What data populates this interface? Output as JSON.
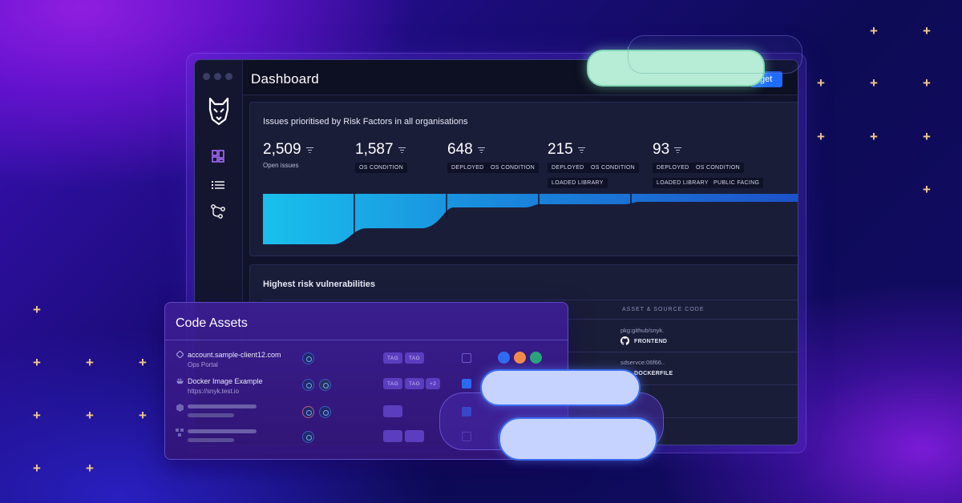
{
  "window": {
    "title": "Dashboard",
    "top_button_label": "get"
  },
  "sidebar": {
    "logo": "wolf-logo-icon",
    "items": [
      {
        "icon": "dashboard-icon"
      },
      {
        "icon": "list-icon"
      },
      {
        "icon": "graph-icon"
      }
    ]
  },
  "risk_card": {
    "title": "Issues prioritised by Risk Factors in all organisations",
    "metrics": [
      {
        "value": "2,509",
        "label": "Open issues",
        "tags": []
      },
      {
        "value": "1,587",
        "tags": [
          "OS CONDITION"
        ]
      },
      {
        "value": "648",
        "tags": [
          "DEPLOYED",
          "OS CONDITION"
        ]
      },
      {
        "value": "215",
        "tags": [
          "DEPLOYED",
          "OS CONDITION",
          "LOADED LIBRARY"
        ]
      },
      {
        "value": "93",
        "tags": [
          "DEPLOYED",
          "OS CONDITION",
          "LOADED LIBRARY",
          "PUBLIC FACING"
        ]
      }
    ]
  },
  "vuln_card": {
    "title": "Highest risk vulnerabilities",
    "column_header": "ASSET & SOURCE CODE",
    "rows": [
      {
        "asset": "pkg:github/snyk.",
        "source": "FRONTEND",
        "source_icon": "github-icon"
      },
      {
        "asset": "sdservce:06f66..",
        "source": "DOCKERFILE",
        "source_icon": "docker-icon"
      }
    ]
  },
  "code_assets": {
    "title": "Code Assets",
    "rows": [
      {
        "name": "account.sample-client12.com",
        "sub": "Ops Portal",
        "tags": [
          "TAG",
          "TAG"
        ]
      },
      {
        "name": "Docker Image Example",
        "sub": "https://snyk.test.io",
        "tags": [
          "TAG",
          "TAG",
          "+2"
        ]
      }
    ]
  },
  "colors": {
    "accent_blue": "#1f6bff",
    "circle_blue": "#2f6bf0",
    "circle_orange": "#f08a4b",
    "circle_green": "#2aa37a",
    "star": "#f3c98a"
  }
}
